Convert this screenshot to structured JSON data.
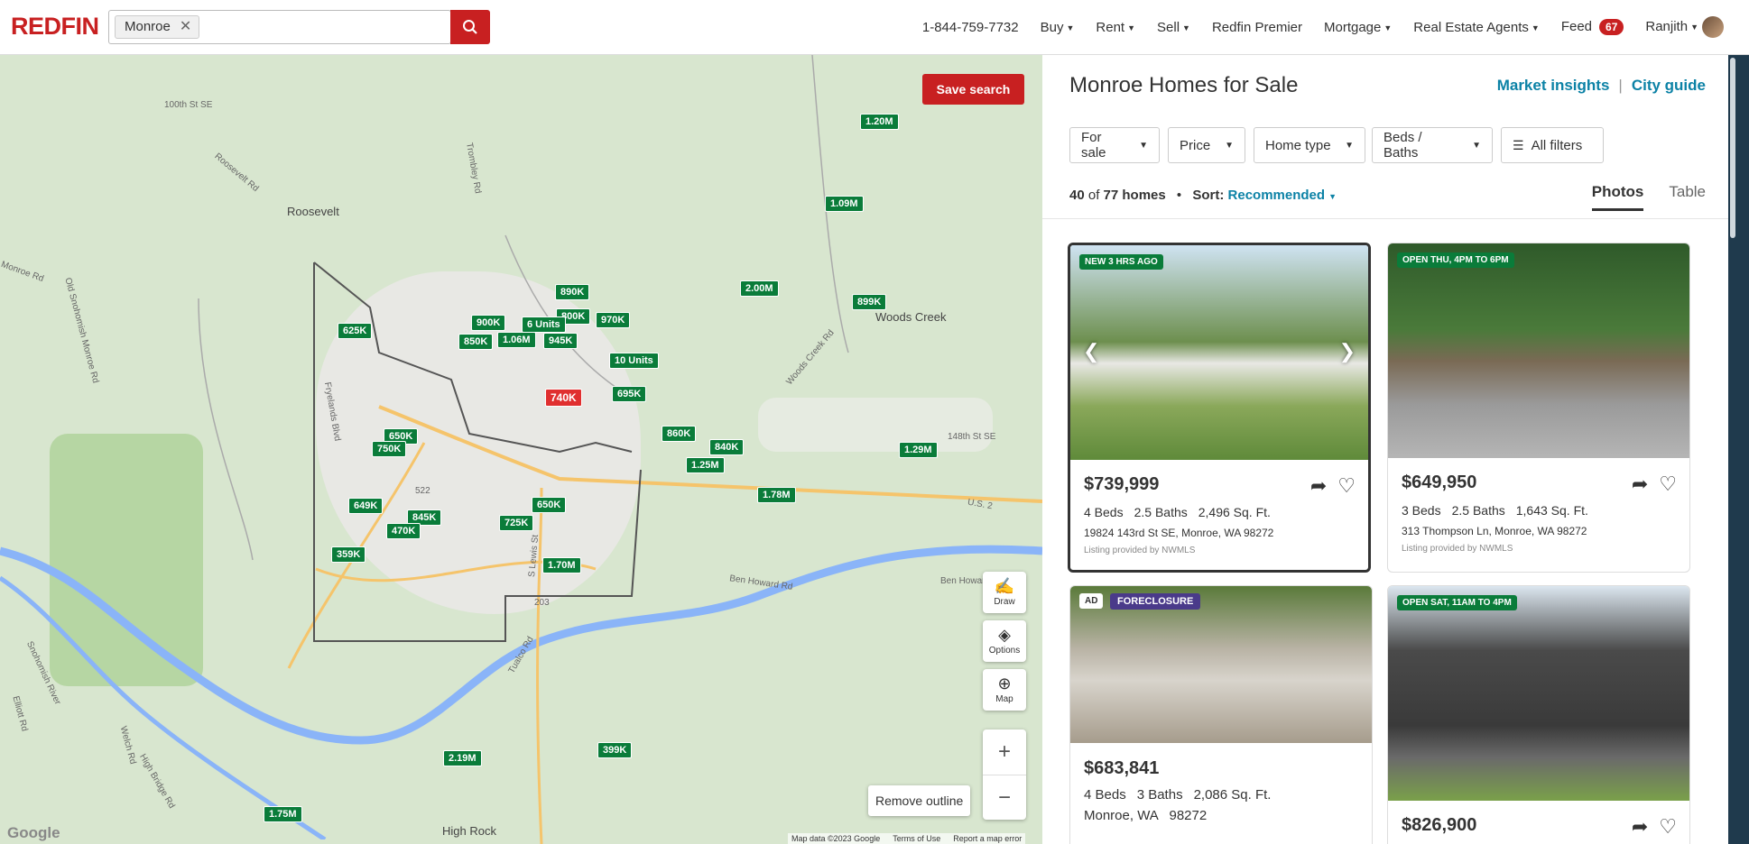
{
  "header": {
    "logo": "REDFIN",
    "search_chip": "Monroe",
    "chip_remove": "✕",
    "phone": "1-844-759-7732",
    "nav": [
      "Buy",
      "Rent",
      "Sell",
      "Redfin Premier",
      "Mortgage",
      "Real Estate Agents",
      "Feed",
      "Ranjith"
    ],
    "feed_count": "67"
  },
  "map": {
    "save_search": "Save search",
    "labels": {
      "roosevelt": "Roosevelt",
      "woods_creek": "Woods Creek",
      "high_rock": "High Rock",
      "st100": "100th St SE",
      "roosevelt_rd": "Roosevelt Rd",
      "old_snoho": "Old Snohomish Monroe Rd",
      "monroe_rd": "Monroe Rd",
      "woods_creek_rd": "Woods Creek Rd",
      "ben_howard": "Ben Howard Rd",
      "ben_howard2": "Ben Howard Rd",
      "snoho_river": "Snohomish River",
      "elliott": "Elliott Rd",
      "high_bridge": "High Bridge Rd",
      "welch": "Welch Rd",
      "us2": "U.S. 2",
      "st148": "148th St SE",
      "tualco": "Tualco Rd",
      "lewis": "S Lewis St",
      "fryelands": "Fryelands Blvd",
      "trombley": "Trombley Rd",
      "r522": "522",
      "r203": "203"
    },
    "pins": [
      "1.20M",
      "1.09M",
      "2.00M",
      "899K",
      "890K",
      "900K",
      "800K",
      "970K",
      "6 Units",
      "625K",
      "850K",
      "1.06M",
      "945K",
      "10 Units",
      "740K",
      "695K",
      "650K",
      "750K",
      "860K",
      "840K",
      "1.25M",
      "1.29M",
      "1.78M",
      "649K",
      "845K",
      "470K",
      "725K",
      "650K",
      "359K",
      "1.70M",
      "2.19M",
      "399K",
      "1.75M"
    ],
    "draw": "Draw",
    "options": "Options",
    "map_btn": "Map",
    "zoom_in": "+",
    "zoom_out": "−",
    "remove_outline": "Remove outline",
    "google": "Google",
    "footer": [
      "Map data ©2023 Google",
      "Terms of Use",
      "Report a map error"
    ]
  },
  "panel": {
    "title": "Monroe Homes for Sale",
    "market_insights": "Market insights",
    "sep": "|",
    "city_guide": "City guide",
    "filters": [
      "For sale",
      "Price",
      "Home type",
      "Beds / Baths",
      "All filters"
    ],
    "count_shown": "40",
    "count_of": "of",
    "count_total": "77 homes",
    "dot": "•",
    "sort_label": "Sort:",
    "sort_value": "Recommended",
    "tabs": [
      "Photos",
      "Table"
    ]
  },
  "listings": [
    {
      "badge": "NEW 3 HRS AGO",
      "price": "$739,999",
      "beds": "4 Beds",
      "baths": "2.5 Baths",
      "sqft": "2,496 Sq. Ft.",
      "address": "19824 143rd St SE, Monroe, WA 98272",
      "source": "Listing provided by NWMLS"
    },
    {
      "badge": "OPEN THU, 4PM TO 6PM",
      "price": "$649,950",
      "beds": "3 Beds",
      "baths": "2.5 Baths",
      "sqft": "1,643 Sq. Ft.",
      "address": "313 Thompson Ln, Monroe, WA 98272",
      "source": "Listing provided by NWMLS"
    },
    {
      "ad": "AD",
      "badge": "FORECLOSURE",
      "price": "$683,841",
      "beds": "4 Beds",
      "baths": "3 Baths",
      "sqft": "2,086 Sq. Ft.",
      "address": "Monroe, WA   98272"
    },
    {
      "badge": "OPEN SAT, 11AM TO 4PM",
      "price": "$826,900"
    }
  ],
  "colors": {
    "brand": "#c82021",
    "pin": "#0a7c3a",
    "link": "#0c82a6"
  }
}
